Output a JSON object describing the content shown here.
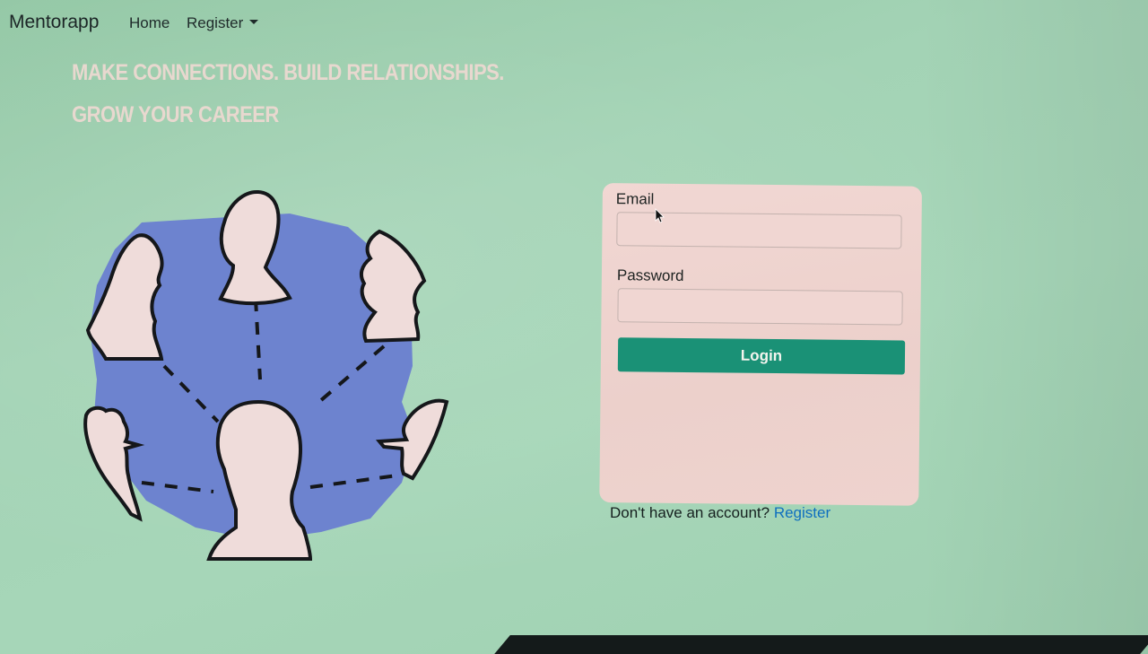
{
  "navbar": {
    "brand": "Mentorapp",
    "home_label": "Home",
    "register_label": "Register",
    "register_icon": "caret-down-icon"
  },
  "hero": {
    "headline": "MAKE CONNECTIONS. BUILD RELATIONSHIPS. GROW YOUR CAREER",
    "illustration": "network-of-people-illustration"
  },
  "login": {
    "email_label": "Email",
    "email_value": "",
    "password_label": "Password",
    "password_value": "",
    "button_label": "Login"
  },
  "signup": {
    "prompt": "Don't have an account?",
    "link_label": "Register"
  },
  "colors": {
    "background": "#a3d3b5",
    "card": "#eed3ce",
    "primary_button": "#1a9176",
    "link": "#0f6fbf",
    "illustration_blue": "#6d83cf",
    "headline": "#e8d8cf"
  }
}
